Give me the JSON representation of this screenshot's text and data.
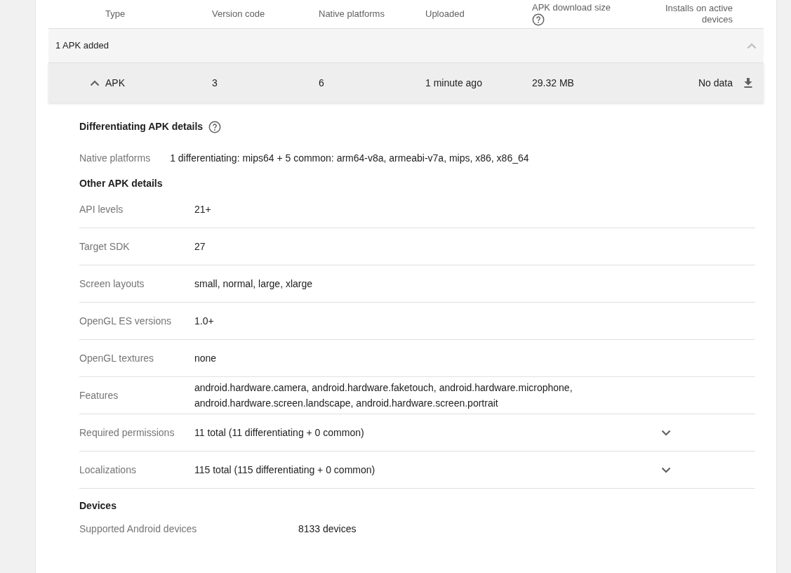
{
  "table": {
    "columns": [
      {
        "label": "Type"
      },
      {
        "label": "Version code"
      },
      {
        "label": "Native platforms"
      },
      {
        "label": "Uploaded"
      },
      {
        "label": "APK download size",
        "help": true
      },
      {
        "label": "Installs on active devices"
      }
    ],
    "group": {
      "label": "1 APK added",
      "expanded": true
    },
    "rows": [
      {
        "expanded": true,
        "cells": [
          "APK",
          "3",
          "6",
          "1 minute ago",
          "29.32 MB",
          "No data"
        ]
      }
    ]
  },
  "sections": [
    {
      "title": "Differentiating APK details",
      "help": true,
      "kind": "wide",
      "rows": [
        {
          "label": "Native platforms",
          "value": "1 differentiating: mips64 + 5 common: arm64-v8a, armeabi-v7a, mips, x86, x86_64"
        }
      ]
    },
    {
      "title": "Other APK details",
      "kind": "table",
      "rows": [
        {
          "label": "API levels",
          "value": "21+"
        },
        {
          "label": "Target SDK",
          "value": "27"
        },
        {
          "label": "Screen layouts",
          "value": "small, normal, large, xlarge"
        },
        {
          "label": "OpenGL ES versions",
          "value": "1.0+"
        },
        {
          "label": "OpenGL textures",
          "value": "none"
        },
        {
          "label": "Features",
          "value": "android.hardware.camera, android.hardware.faketouch, android.hardware.microphone, android.hardware.screen.landscape, android.hardware.screen.portrait"
        },
        {
          "label": "Required permissions",
          "value": "11 total (11 differentiating + 0 common)",
          "expandable": true
        },
        {
          "label": "Localizations",
          "value": "115 total (115 differentiating + 0 common)",
          "expandable": true
        }
      ]
    },
    {
      "title": "Devices",
      "kind": "devices",
      "rows": [
        {
          "label": "Supported Android devices",
          "value": "8133 devices"
        }
      ]
    }
  ]
}
